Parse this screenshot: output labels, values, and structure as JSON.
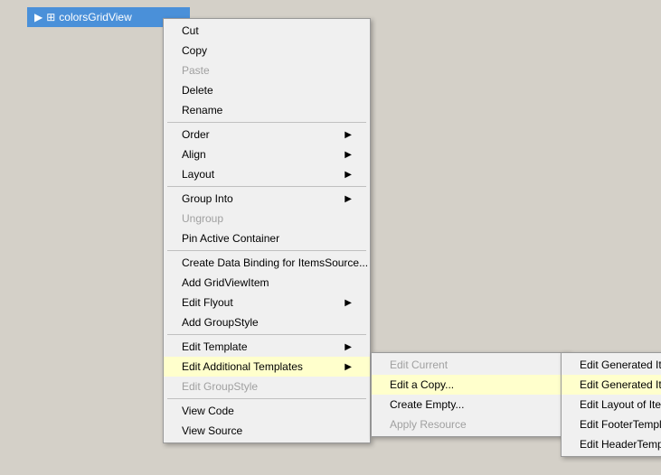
{
  "titlebar": {
    "label": "colorsGridView",
    "icon": "⊞"
  },
  "primaryMenu": {
    "items": [
      {
        "id": "cut",
        "label": "Cut",
        "enabled": true,
        "hasSubmenu": false
      },
      {
        "id": "copy",
        "label": "Copy",
        "enabled": true,
        "hasSubmenu": false
      },
      {
        "id": "paste",
        "label": "Paste",
        "enabled": false,
        "hasSubmenu": false
      },
      {
        "id": "delete",
        "label": "Delete",
        "enabled": true,
        "hasSubmenu": false
      },
      {
        "id": "rename",
        "label": "Rename",
        "enabled": true,
        "hasSubmenu": false
      },
      {
        "id": "sep1",
        "type": "separator"
      },
      {
        "id": "order",
        "label": "Order",
        "enabled": true,
        "hasSubmenu": true
      },
      {
        "id": "align",
        "label": "Align",
        "enabled": true,
        "hasSubmenu": true
      },
      {
        "id": "layout",
        "label": "Layout",
        "enabled": true,
        "hasSubmenu": true
      },
      {
        "id": "sep2",
        "type": "separator"
      },
      {
        "id": "groupinto",
        "label": "Group Into",
        "enabled": true,
        "hasSubmenu": true
      },
      {
        "id": "ungroup",
        "label": "Ungroup",
        "enabled": false,
        "hasSubmenu": false
      },
      {
        "id": "pinactive",
        "label": "Pin Active Container",
        "enabled": true,
        "hasSubmenu": false
      },
      {
        "id": "sep3",
        "type": "separator"
      },
      {
        "id": "databinding",
        "label": "Create Data Binding for ItemsSource...",
        "enabled": true,
        "hasSubmenu": false
      },
      {
        "id": "addgridview",
        "label": "Add GridViewItem",
        "enabled": true,
        "hasSubmenu": false
      },
      {
        "id": "editflyout",
        "label": "Edit Flyout",
        "enabled": true,
        "hasSubmenu": true
      },
      {
        "id": "addgroupstyle",
        "label": "Add GroupStyle",
        "enabled": true,
        "hasSubmenu": false
      },
      {
        "id": "sep4",
        "type": "separator"
      },
      {
        "id": "edittemplate",
        "label": "Edit Template",
        "enabled": true,
        "hasSubmenu": true
      },
      {
        "id": "editadditional",
        "label": "Edit Additional Templates",
        "enabled": true,
        "hasSubmenu": true,
        "highlighted": true
      },
      {
        "id": "editgroupstyle2",
        "label": "Edit GroupStyle",
        "enabled": false,
        "hasSubmenu": false
      },
      {
        "id": "sep5",
        "type": "separator"
      },
      {
        "id": "viewcode",
        "label": "View Code",
        "enabled": true,
        "hasSubmenu": false
      },
      {
        "id": "viewsource",
        "label": "View Source",
        "enabled": true,
        "hasSubmenu": false
      }
    ]
  },
  "secondaryMenu": {
    "items": [
      {
        "id": "editcurrent",
        "label": "Edit Current",
        "enabled": false,
        "hasSubmenu": false
      },
      {
        "id": "editacopy",
        "label": "Edit a Copy...",
        "enabled": true,
        "hasSubmenu": false,
        "highlighted": true
      },
      {
        "id": "createempty",
        "label": "Create Empty...",
        "enabled": true,
        "hasSubmenu": false
      },
      {
        "id": "applyresource",
        "label": "Apply Resource",
        "enabled": false,
        "hasSubmenu": false
      }
    ]
  },
  "tertiaryMenu": {
    "items": [
      {
        "id": "editgenerated",
        "label": "Edit Generated Items (ItemTemplate)",
        "enabled": true,
        "hasSubmenu": true
      },
      {
        "id": "editcontainer",
        "label": "Edit Generated Item Container (ItemContainerStyle)",
        "enabled": true,
        "hasSubmenu": true,
        "highlighted": true
      },
      {
        "id": "editlayout",
        "label": "Edit Layout of Items (ItemsPanel)",
        "enabled": true,
        "hasSubmenu": true
      },
      {
        "id": "editfooter",
        "label": "Edit FooterTemplate",
        "enabled": true,
        "hasSubmenu": false
      },
      {
        "id": "editheader",
        "label": "Edit HeaderTemplate",
        "enabled": true,
        "hasSubmenu": false
      }
    ]
  }
}
